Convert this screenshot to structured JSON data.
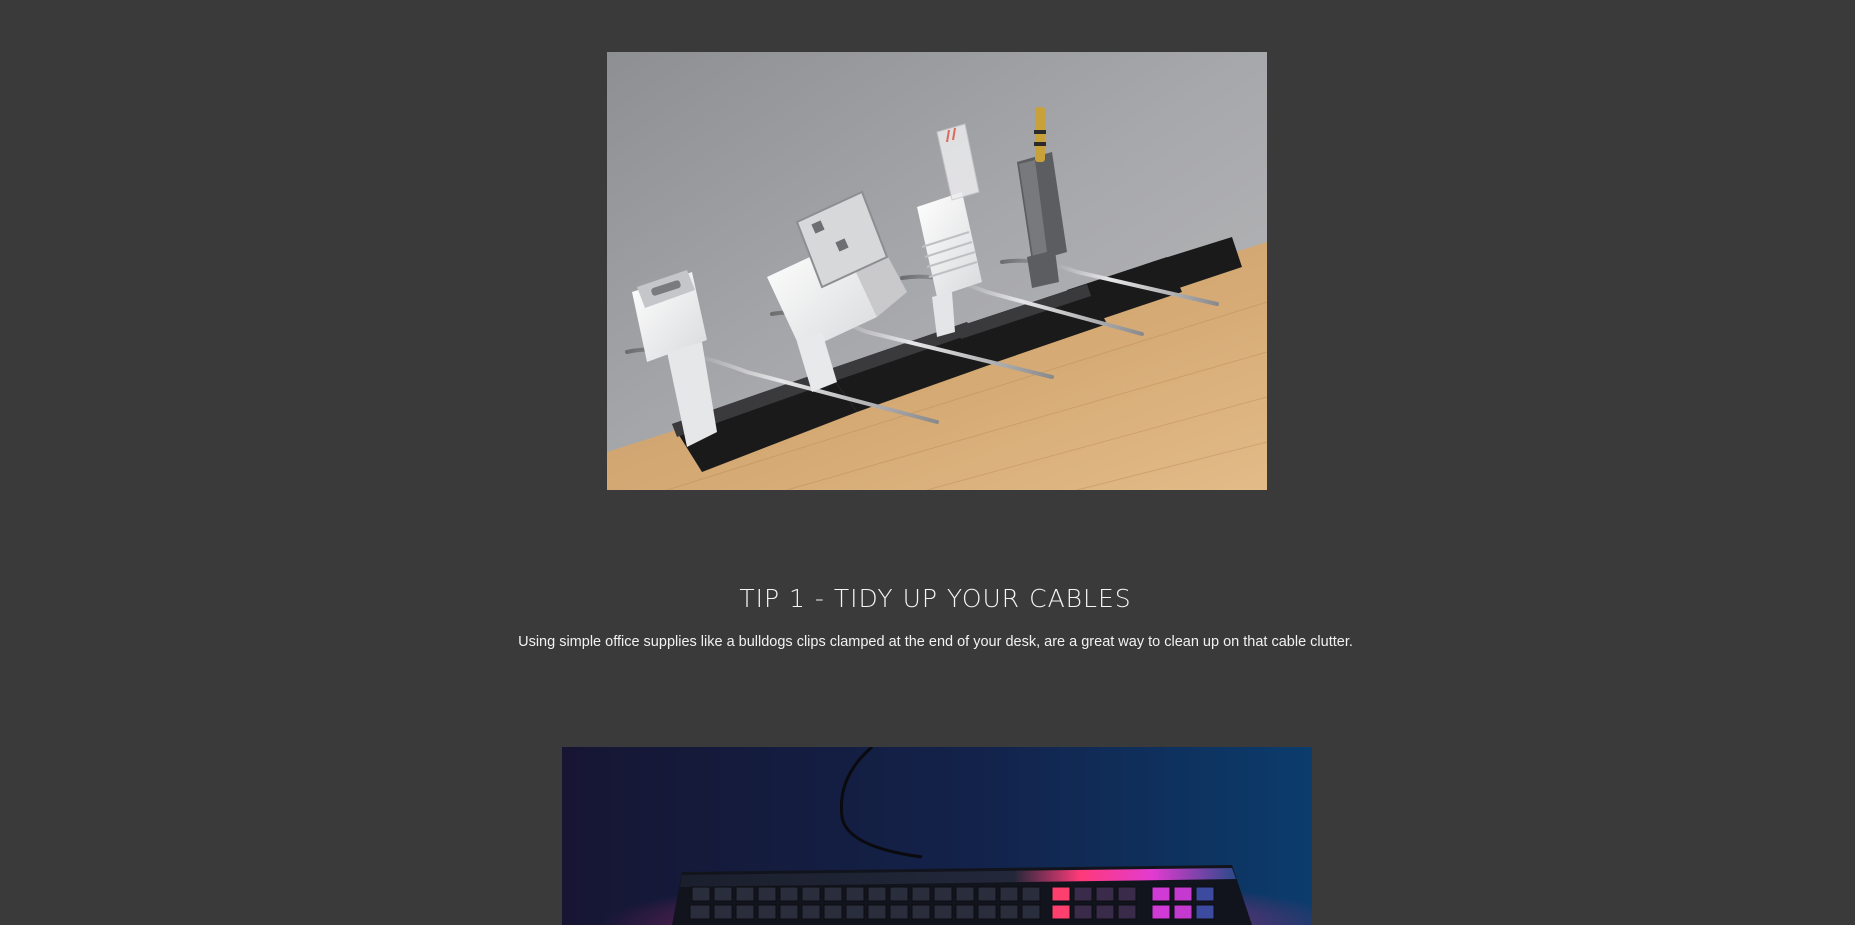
{
  "tips": [
    {
      "title": "TIP 1 - TIDY UP YOUR CABLES",
      "description": "Using simple office supplies like a bulldogs clips clamped at the end of your desk, are a great way to clean up on that cable clutter.",
      "image": "cables-in-binder-clips-photo"
    }
  ],
  "next_image": "rgb-keyboard-photo"
}
